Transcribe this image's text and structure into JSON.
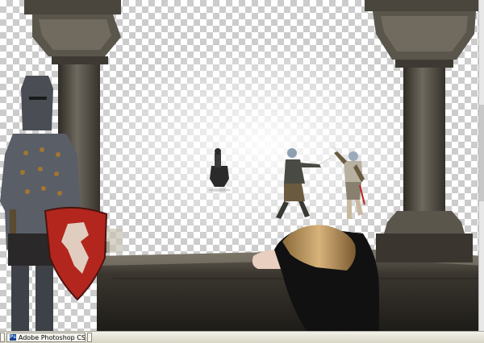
{
  "window": {
    "taskbar": {
      "items": [
        {
          "label": "Adobe Photoshop CS4 -",
          "icon": "photoshop-icon",
          "active": true
        }
      ]
    }
  },
  "canvas": {
    "background": "transparency-checkerboard",
    "layers": [
      "pillar-left",
      "pillar-right",
      "stone-balcony-ledge",
      "knight-with-shield",
      "lion-heraldic-shield",
      "woman-leaning-on-ledge",
      "horseman-distant",
      "sword-fighter-left",
      "sword-fighter-right"
    ]
  },
  "colors": {
    "stone": "#6a655b",
    "stone_dark": "#2f2c26",
    "shield_red": "#b3261e",
    "checker_light": "#ffffff",
    "checker_dark": "#cccccc"
  }
}
